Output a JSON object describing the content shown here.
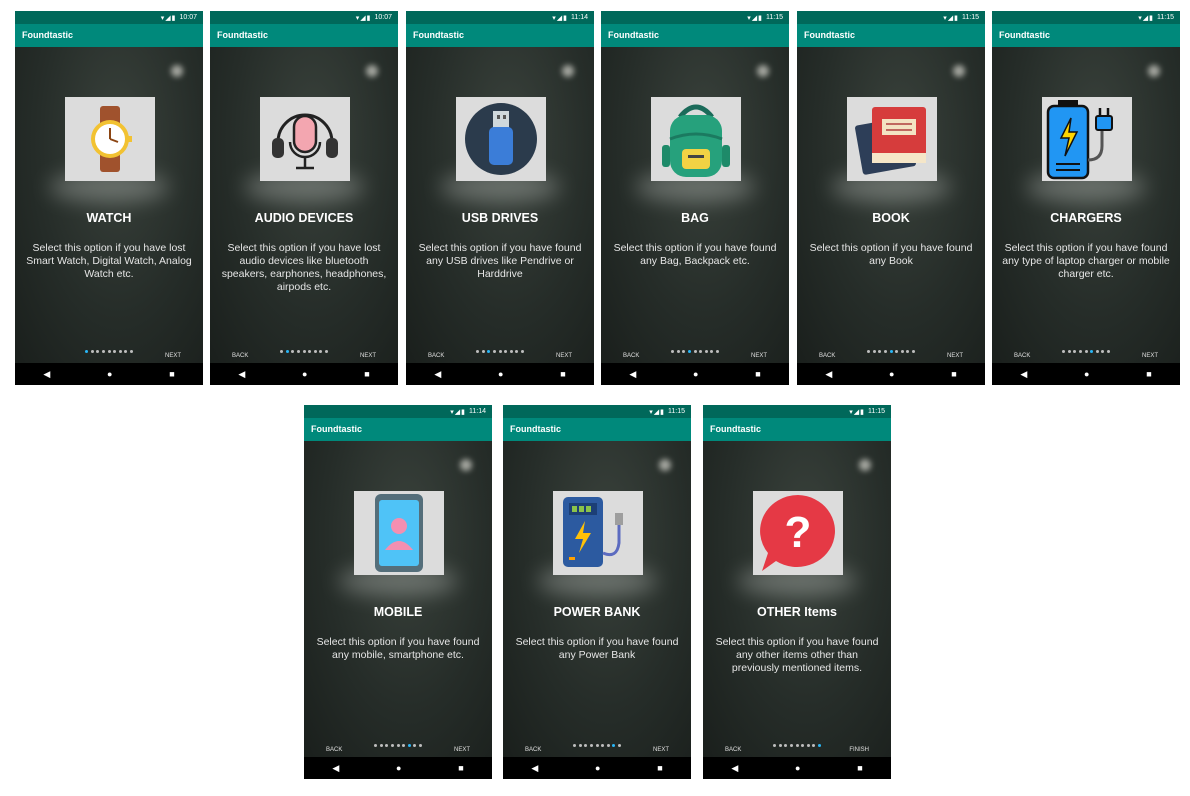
{
  "app_name": "Foundtastic",
  "screens": [
    {
      "time": "10:07",
      "title": "WATCH",
      "desc": "Select this option if you have lost Smart Watch, Digital Watch, Analog Watch etc.",
      "back": "",
      "next": "NEXT",
      "page": 0,
      "icon": "watch-icon"
    },
    {
      "time": "10:07",
      "title": "AUDIO DEVICES",
      "desc": "Select this option if you have lost audio devices like bluetooth speakers, earphones, headphones, airpods etc.",
      "back": "BACK",
      "next": "NEXT",
      "page": 1,
      "icon": "headphones-microphone-icon"
    },
    {
      "time": "11:14",
      "title": "USB DRIVES",
      "desc": "Select this option if you have found any USB drives like Pendrive or Harddrive",
      "back": "BACK",
      "next": "NEXT",
      "page": 2,
      "icon": "usb-drive-icon"
    },
    {
      "time": "11:15",
      "title": "BAG",
      "desc": "Select this option if you have found any Bag, Backpack etc.",
      "back": "BACK",
      "next": "NEXT",
      "page": 3,
      "icon": "backpack-icon"
    },
    {
      "time": "11:15",
      "title": "BOOK",
      "desc": "Select this option if you have found any Book",
      "back": "BACK",
      "next": "NEXT",
      "page": 4,
      "icon": "book-icon"
    },
    {
      "time": "11:15",
      "title": "CHARGERS",
      "desc": "Select this option if you have found any type of laptop charger or mobile charger etc.",
      "back": "BACK",
      "next": "NEXT",
      "page": 5,
      "icon": "charger-icon"
    },
    {
      "time": "11:14",
      "title": "MOBILE",
      "desc": "Select this option if you have found any mobile, smartphone etc.",
      "back": "BACK",
      "next": "NEXT",
      "page": 6,
      "icon": "smartphone-icon"
    },
    {
      "time": "11:15",
      "title": "POWER BANK",
      "desc": "Select this option if you have found any Power Bank",
      "back": "BACK",
      "next": "NEXT",
      "page": 7,
      "icon": "power-bank-icon"
    },
    {
      "time": "11:15",
      "title": "OTHER Items",
      "desc": "Select this option if you have found any other items other than previously mentioned items.",
      "back": "BACK",
      "next": "FINISH",
      "page": 8,
      "icon": "question-bubble-icon"
    }
  ],
  "page_count": 9,
  "nav": {
    "back_icon": "triangle-back-icon",
    "home_icon": "circle-home-icon",
    "recents_icon": "square-recents-icon"
  }
}
